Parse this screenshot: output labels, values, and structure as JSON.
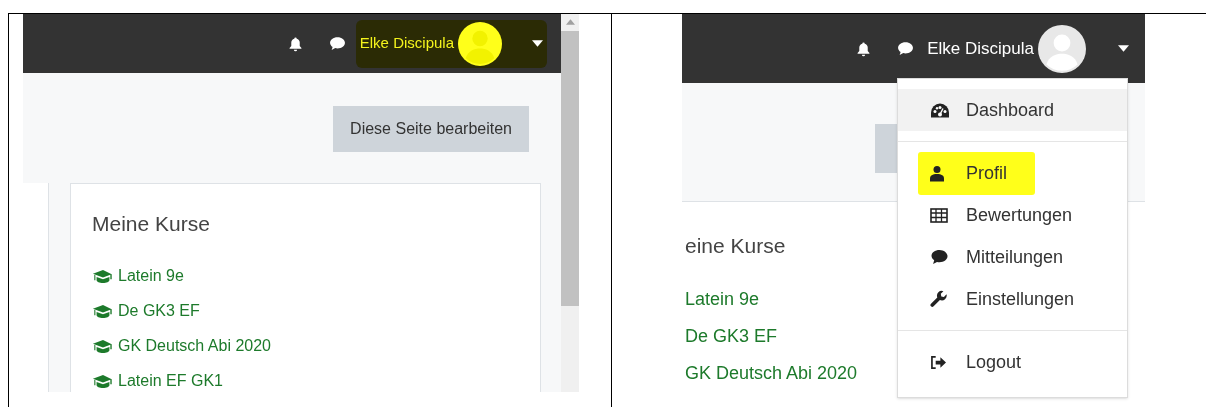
{
  "panels": [
    {
      "user": {
        "name": "Elke Discipula",
        "highlighted": true
      },
      "edit_button": "Diese Seite bearbeiten",
      "block_title": "Meine Kurse",
      "course_icons": true,
      "scrollbar": true,
      "courses": [
        "Latein 9e",
        "De GK3 EF",
        "GK Deutsch Abi 2020",
        "Latein EF GK1"
      ]
    },
    {
      "user": {
        "name": "Elke Discipula",
        "highlighted": false
      },
      "block_title": "eine Kurse",
      "course_icons": false,
      "scrollbar": false,
      "courses": [
        "Latein 9e",
        "De GK3 EF",
        "GK Deutsch Abi 2020"
      ],
      "menu": [
        {
          "kind": "dashboard",
          "label": "Dashboard",
          "selected": true,
          "highlighted": false
        },
        {
          "kind": "divider"
        },
        {
          "kind": "profile",
          "label": "Profil",
          "selected": false,
          "highlighted": true
        },
        {
          "kind": "grades",
          "label": "Bewertungen",
          "selected": false,
          "highlighted": false
        },
        {
          "kind": "messages",
          "label": "Mitteilungen",
          "selected": false,
          "highlighted": false
        },
        {
          "kind": "preferences",
          "label": "Einstellungen",
          "selected": false,
          "highlighted": false
        },
        {
          "kind": "divider"
        },
        {
          "kind": "logout",
          "label": "Logout",
          "selected": false,
          "highlighted": false
        }
      ]
    }
  ]
}
